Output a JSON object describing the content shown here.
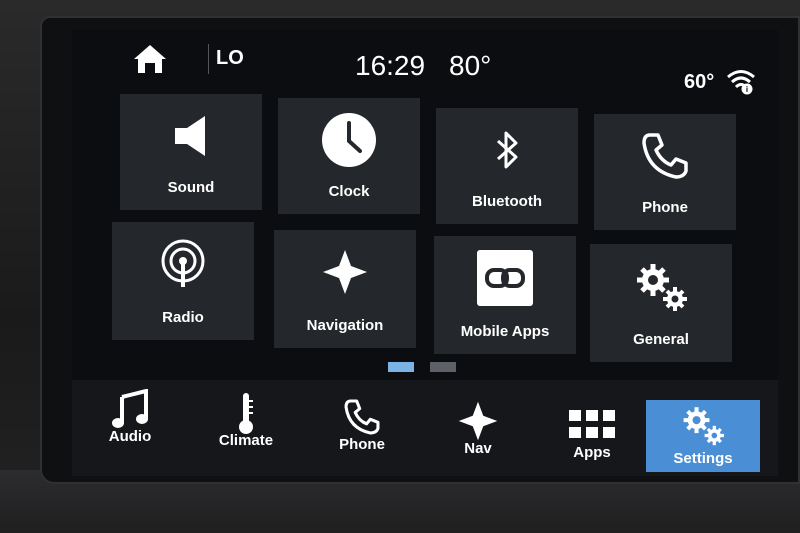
{
  "status_bar": {
    "fan_label": "LO",
    "time": "16:29",
    "inside_temp": "80°",
    "outside_temp": "60°"
  },
  "tiles": [
    {
      "label": "Sound",
      "icon": "speaker-icon"
    },
    {
      "label": "Clock",
      "icon": "clock-icon"
    },
    {
      "label": "Bluetooth",
      "icon": "bluetooth-icon"
    },
    {
      "label": "Phone",
      "icon": "phone-icon"
    },
    {
      "label": "Radio",
      "icon": "radio-icon"
    },
    {
      "label": "Navigation",
      "icon": "navigation-icon"
    },
    {
      "label": "Mobile Apps",
      "icon": "mobile-apps-icon"
    },
    {
      "label": "General",
      "icon": "gears-icon"
    }
  ],
  "pager": {
    "pages": 2,
    "current": 1
  },
  "dock": [
    {
      "label": "Audio",
      "icon": "music-note-icon"
    },
    {
      "label": "Climate",
      "icon": "thermometer-icon"
    },
    {
      "label": "Phone",
      "icon": "phone-icon"
    },
    {
      "label": "Nav",
      "icon": "navigation-icon"
    },
    {
      "label": "Apps",
      "icon": "apps-grid-icon"
    },
    {
      "label": "Settings",
      "icon": "gears-icon",
      "active": true
    }
  ],
  "colors": {
    "accent": "#4a8fd6",
    "tile_bg": "#24272b",
    "screen_bg": "#0c0d10",
    "pager_active": "#7cb3e6"
  }
}
